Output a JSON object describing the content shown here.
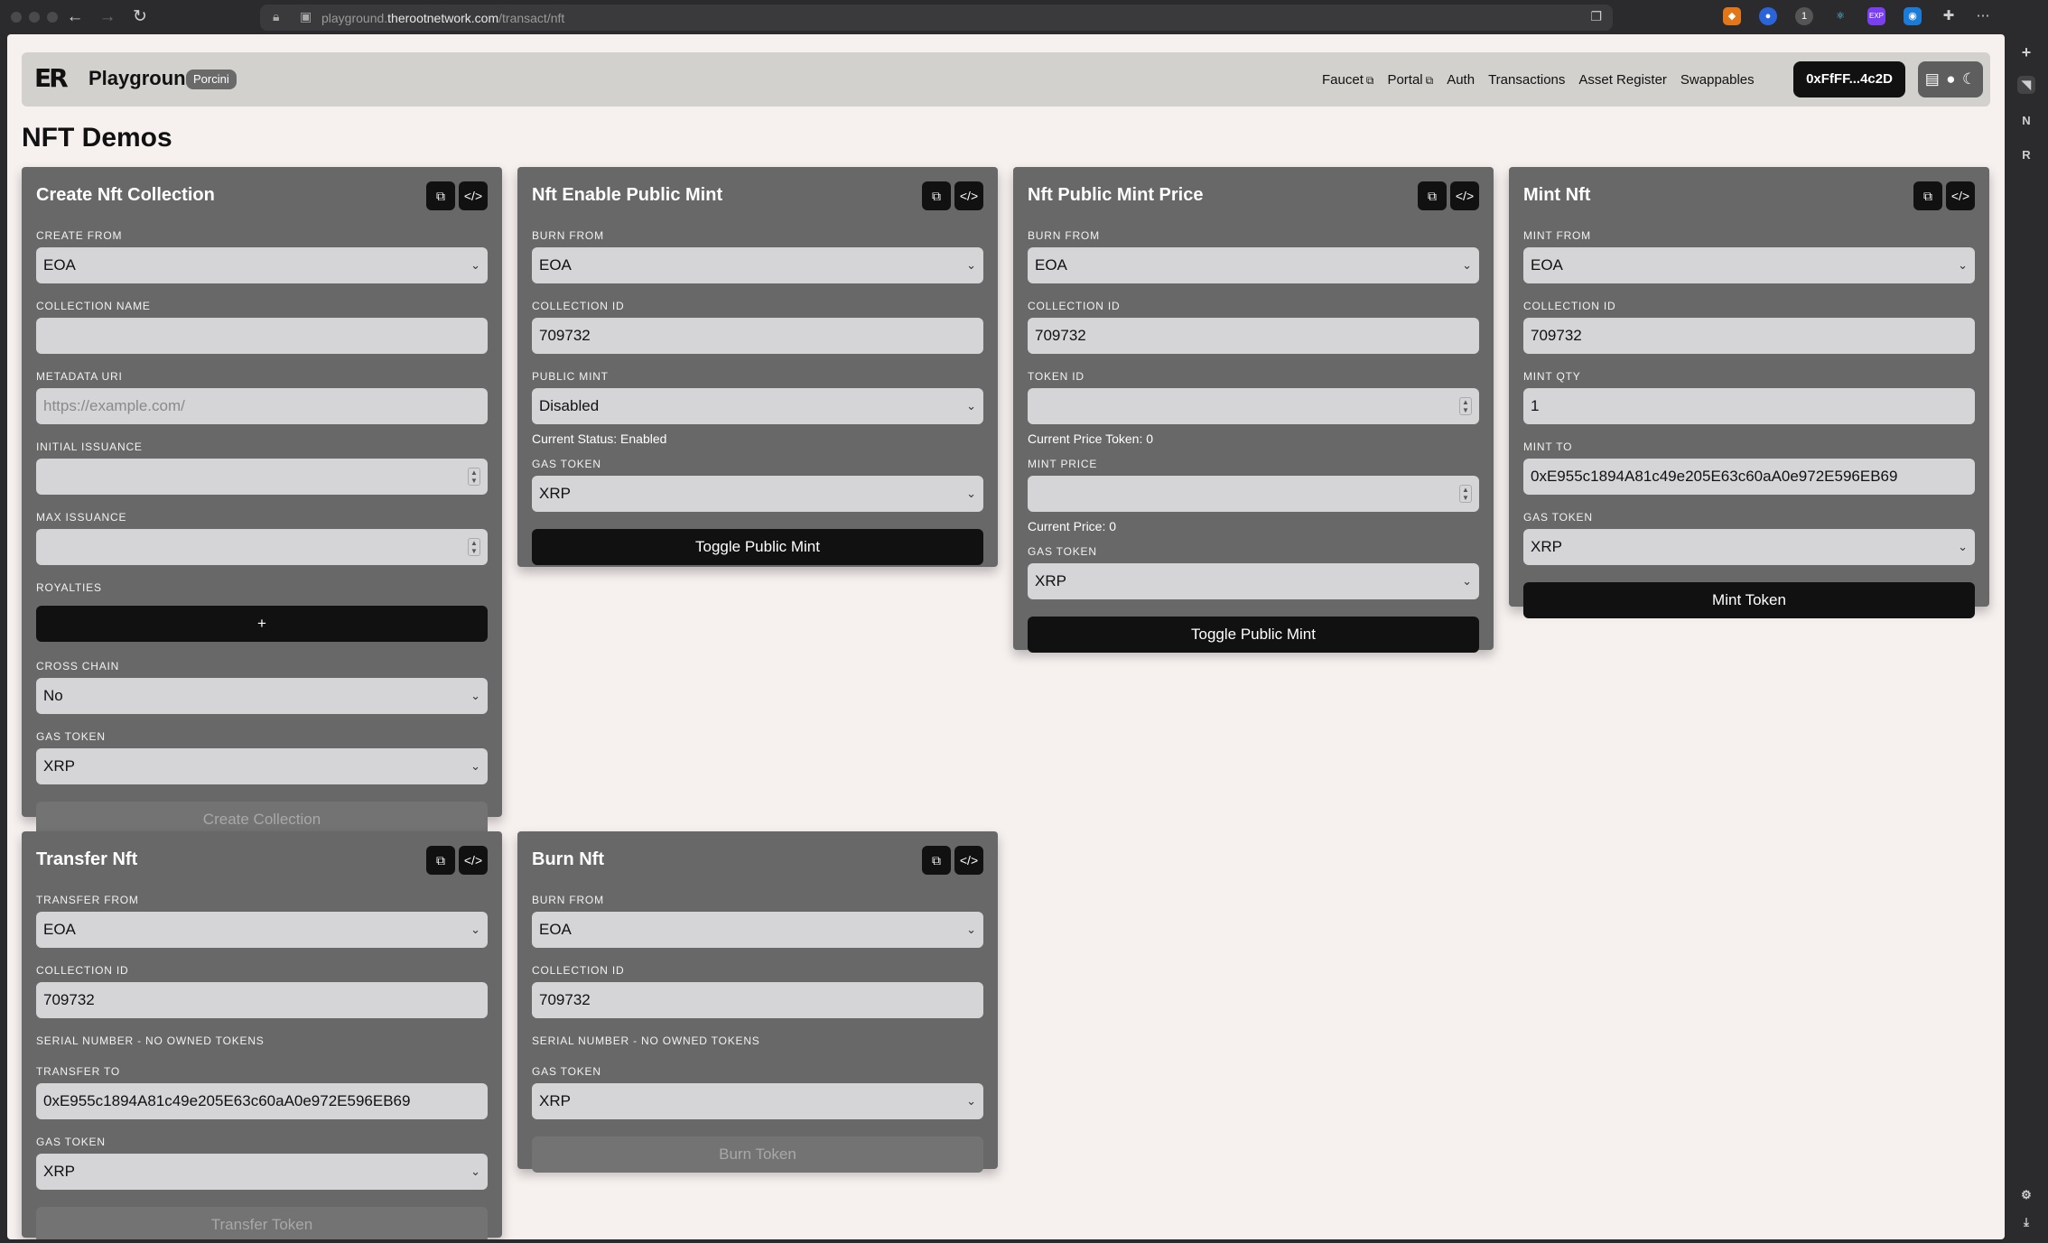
{
  "browser": {
    "url_prefix": "playground.",
    "url_domain": "therootnetwork.com",
    "url_path": "/transact/nft",
    "extension_badge": "EXP",
    "extension_count": "1"
  },
  "header": {
    "logo_mark": "ER",
    "app_name": "Playground",
    "network_badge": "Porcini",
    "nav": {
      "faucet": "Faucet",
      "portal": "Portal",
      "auth": "Auth",
      "transactions": "Transactions",
      "asset_register": "Asset Register",
      "swappables": "Swappables"
    },
    "wallet": "0xFfFF...4c2D"
  },
  "page": {
    "title": "NFT Demos"
  },
  "cards": {
    "create": {
      "title": "Create Nft Collection",
      "create_from_label": "CREATE FROM",
      "create_from_value": "EOA",
      "collection_name_label": "COLLECTION NAME",
      "metadata_uri_label": "METADATA URI",
      "metadata_uri_placeholder": "https://example.com/",
      "initial_issuance_label": "INITIAL ISSUANCE",
      "max_issuance_label": "MAX ISSUANCE",
      "royalties_label": "ROYALTIES",
      "add_royalty": "+",
      "cross_chain_label": "CROSS CHAIN",
      "cross_chain_value": "No",
      "gas_token_label": "GAS TOKEN",
      "gas_token_value": "XRP",
      "submit": "Create Collection"
    },
    "enable_public_mint": {
      "title": "Nft Enable Public Mint",
      "burn_from_label": "BURN FROM",
      "burn_from_value": "EOA",
      "collection_id_label": "COLLECTION ID",
      "collection_id_value": "709732",
      "public_mint_label": "PUBLIC MINT",
      "public_mint_value": "Disabled",
      "status_text": "Current Status: Enabled",
      "gas_token_label": "GAS TOKEN",
      "gas_token_value": "XRP",
      "submit": "Toggle Public Mint"
    },
    "public_mint_price": {
      "title": "Nft Public Mint Price",
      "burn_from_label": "BURN FROM",
      "burn_from_value": "EOA",
      "collection_id_label": "COLLECTION ID",
      "collection_id_value": "709732",
      "token_id_label": "TOKEN ID",
      "price_token_text": "Current Price Token: 0",
      "mint_price_label": "MINT PRICE",
      "price_text": "Current Price: 0",
      "gas_token_label": "GAS TOKEN",
      "gas_token_value": "XRP",
      "submit": "Toggle Public Mint"
    },
    "mint": {
      "title": "Mint Nft",
      "mint_from_label": "MINT FROM",
      "mint_from_value": "EOA",
      "collection_id_label": "COLLECTION ID",
      "collection_id_value": "709732",
      "mint_qty_label": "MINT QTY",
      "mint_qty_value": "1",
      "mint_to_label": "MINT TO",
      "mint_to_value": "0xE955c1894A81c49e205E63c60aA0e972E596EB69",
      "gas_token_label": "GAS TOKEN",
      "gas_token_value": "XRP",
      "submit": "Mint Token"
    },
    "transfer": {
      "title": "Transfer Nft",
      "transfer_from_label": "TRANSFER FROM",
      "transfer_from_value": "EOA",
      "collection_id_label": "COLLECTION ID",
      "collection_id_value": "709732",
      "serial_label": "SERIAL NUMBER - NO OWNED TOKENS",
      "transfer_to_label": "TRANSFER TO",
      "transfer_to_value": "0xE955c1894A81c49e205E63c60aA0e972E596EB69",
      "gas_token_label": "GAS TOKEN",
      "gas_token_value": "XRP",
      "submit": "Transfer Token"
    },
    "burn": {
      "title": "Burn Nft",
      "burn_from_label": "BURN FROM",
      "burn_from_value": "EOA",
      "collection_id_label": "COLLECTION ID",
      "collection_id_value": "709732",
      "serial_label": "SERIAL NUMBER - NO OWNED TOKENS",
      "gas_token_label": "GAS TOKEN",
      "gas_token_value": "XRP",
      "submit": "Burn Token"
    }
  },
  "icons": {
    "copy": "copy-icon",
    "code": "code-icon",
    "chevron": "chevron-down-icon",
    "external": "external-link-icon",
    "docs": "document-icon",
    "github": "github-icon",
    "theme": "moon-icon"
  }
}
